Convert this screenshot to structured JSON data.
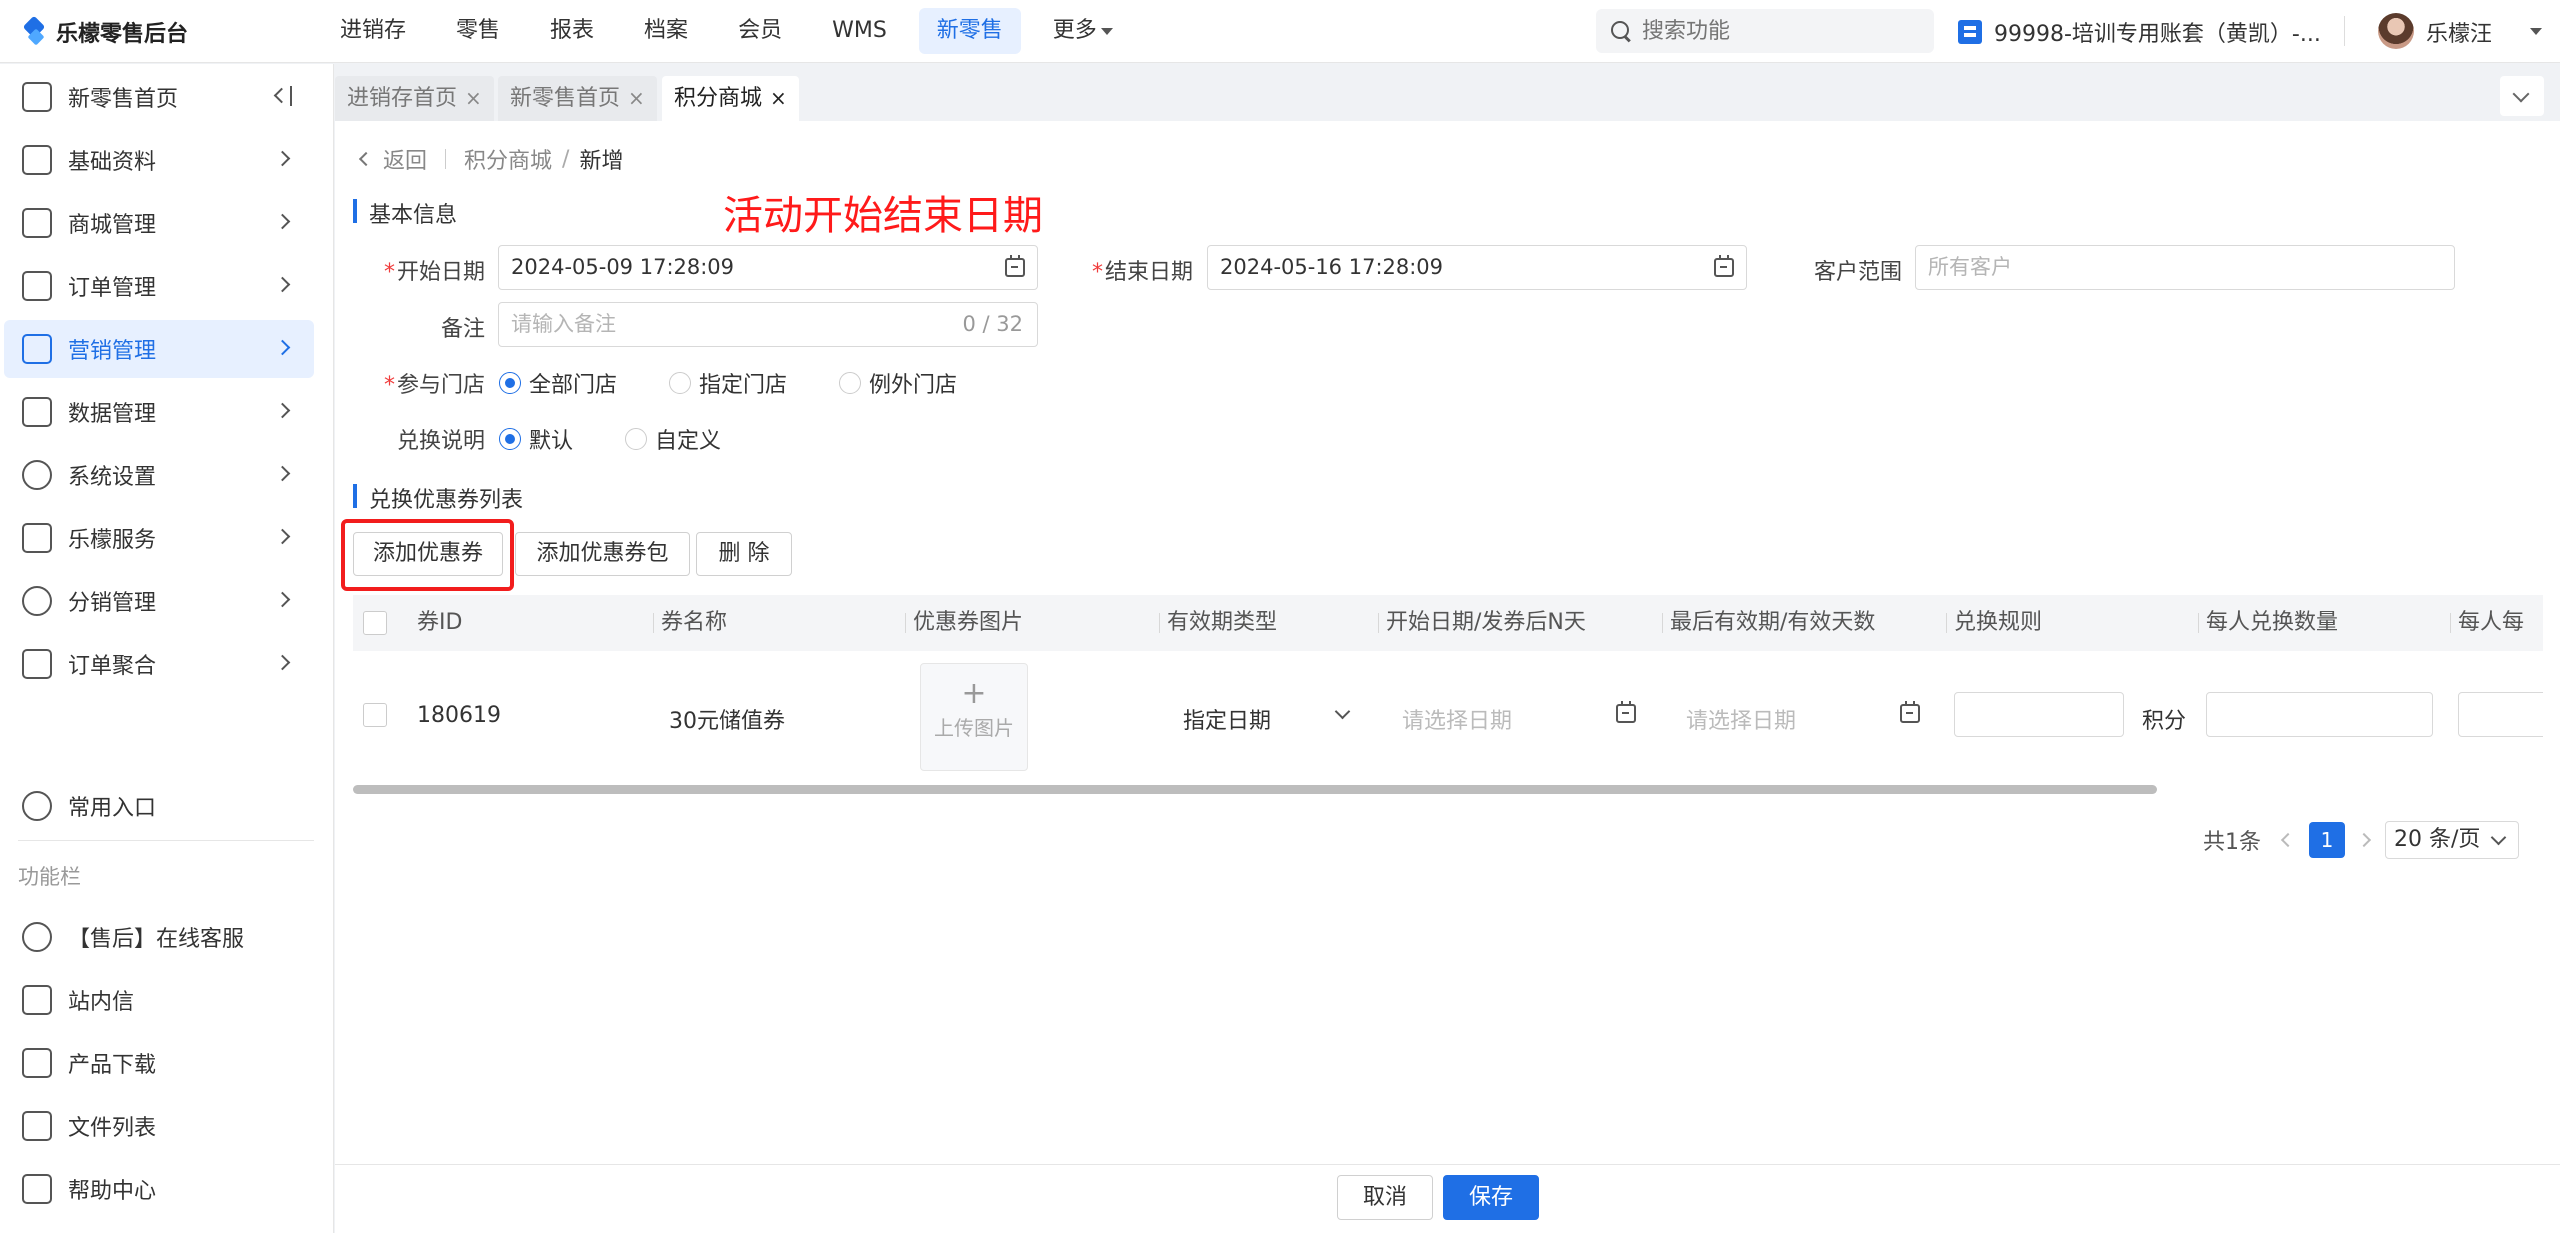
{
  "app": {
    "title": "乐檬零售后台"
  },
  "topnav": {
    "items": [
      "进销存",
      "零售",
      "报表",
      "档案",
      "会员",
      "WMS",
      "新零售",
      "更多"
    ],
    "active": "新零售"
  },
  "search": {
    "placeholder": "搜索功能"
  },
  "account": {
    "store": "99998-培训专用账套（黄凯）-..."
  },
  "user": {
    "name": "乐檬汪"
  },
  "sidebar": {
    "items": [
      {
        "label": "新零售首页",
        "icon": "home-icon"
      },
      {
        "label": "基础资料",
        "icon": "grid-icon"
      },
      {
        "label": "商城管理",
        "icon": "shop-icon"
      },
      {
        "label": "订单管理",
        "icon": "order-icon"
      },
      {
        "label": "营销管理",
        "icon": "marketing-icon"
      },
      {
        "label": "数据管理",
        "icon": "chart-icon"
      },
      {
        "label": "系统设置",
        "icon": "settings-icon"
      },
      {
        "label": "乐檬服务",
        "icon": "service-icon"
      },
      {
        "label": "分销管理",
        "icon": "distribution-icon"
      },
      {
        "label": "订单聚合",
        "icon": "aggregate-icon"
      }
    ],
    "favorites": "常用入口",
    "group_label": "功能栏",
    "tools": [
      {
        "label": "【售后】在线客服",
        "icon": "headset-icon"
      },
      {
        "label": "站内信",
        "icon": "mail-icon"
      },
      {
        "label": "产品下载",
        "icon": "download-icon"
      },
      {
        "label": "文件列表",
        "icon": "file-list-icon"
      },
      {
        "label": "帮助中心",
        "icon": "help-icon"
      }
    ],
    "active": "营销管理"
  },
  "tabs": [
    {
      "label": "进销存首页",
      "close": "×"
    },
    {
      "label": "新零售首页",
      "close": "×"
    },
    {
      "label": "积分商城",
      "close": "×"
    }
  ],
  "breadcrumb": {
    "back": "返回",
    "parent": "积分商城",
    "sep": "/",
    "current": "新增"
  },
  "annotation": "活动开始结束日期",
  "basic": {
    "title": "基本信息",
    "start_label": "开始日期",
    "start_value": "2024-05-09 17:28:09",
    "end_label": "结束日期",
    "end_value": "2024-05-16 17:28:09",
    "customer_label": "客户范围",
    "customer_placeholder": "所有客户",
    "remark_label": "备注",
    "remark_placeholder": "请输入备注",
    "remark_counter": "0 / 32",
    "store_label": "参与门店",
    "store_options": [
      "全部门店",
      "指定门店",
      "例外门店"
    ],
    "store_selected": "全部门店",
    "explain_label": "兑换说明",
    "explain_options": [
      "默认",
      "自定义"
    ],
    "explain_selected": "默认",
    "required_mark": "*"
  },
  "coupon_list": {
    "title": "兑换优惠券列表",
    "buttons": {
      "add_coupon": "添加优惠券",
      "add_package": "添加优惠券包",
      "delete": "删 除"
    },
    "columns": [
      "券ID",
      "券名称",
      "优惠券图片",
      "有效期类型",
      "开始日期/发券后N天",
      "最后有效期/有效天数",
      "兑换规则",
      "每人兑换数量",
      "每人每"
    ],
    "rows": [
      {
        "id": "180619",
        "name": "30元储值券",
        "image_upload": "上传图片",
        "image_plus": "+",
        "validity_type": "指定日期",
        "start_placeholder": "请选择日期",
        "end_placeholder": "请选择日期",
        "rule_unit": "积分"
      }
    ]
  },
  "pagination": {
    "total": "共1条",
    "current": "1",
    "page_size": "20 条/页"
  },
  "footer": {
    "cancel": "取消",
    "save": "保存"
  },
  "colors": {
    "primary": "#1f6fe5",
    "annotation": "#ff1a1a",
    "required": "#f03c3c"
  }
}
